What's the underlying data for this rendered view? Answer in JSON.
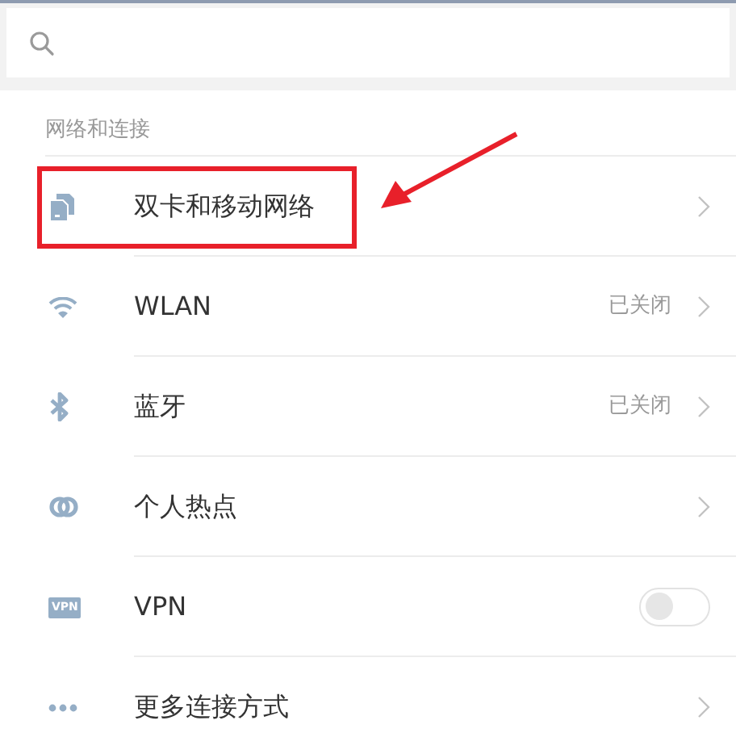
{
  "section": {
    "title": "网络和连接"
  },
  "items": [
    {
      "kind": "link",
      "label": "双卡和移动网络",
      "highlighted": true
    },
    {
      "kind": "link",
      "label": "WLAN",
      "value": "已关闭",
      "highlighted": false
    },
    {
      "kind": "link",
      "label": "蓝牙",
      "value": "已关闭",
      "highlighted": false
    },
    {
      "kind": "link",
      "label": "个人热点",
      "highlighted": false
    },
    {
      "kind": "toggle",
      "label": "VPN",
      "icon_text": "VPN",
      "on": false,
      "highlighted": false
    },
    {
      "kind": "link",
      "label": "更多连接方式",
      "highlighted": false
    }
  ]
}
